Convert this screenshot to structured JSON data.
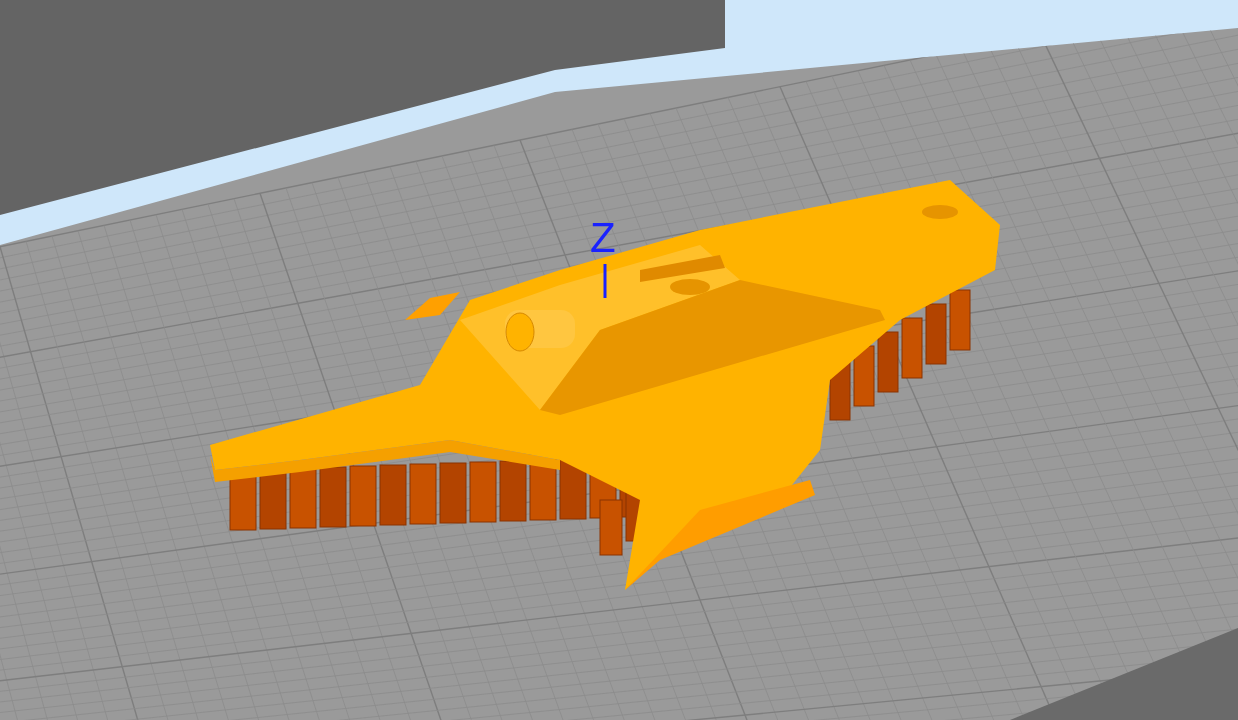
{
  "viewport": {
    "axis_label": "Z"
  }
}
